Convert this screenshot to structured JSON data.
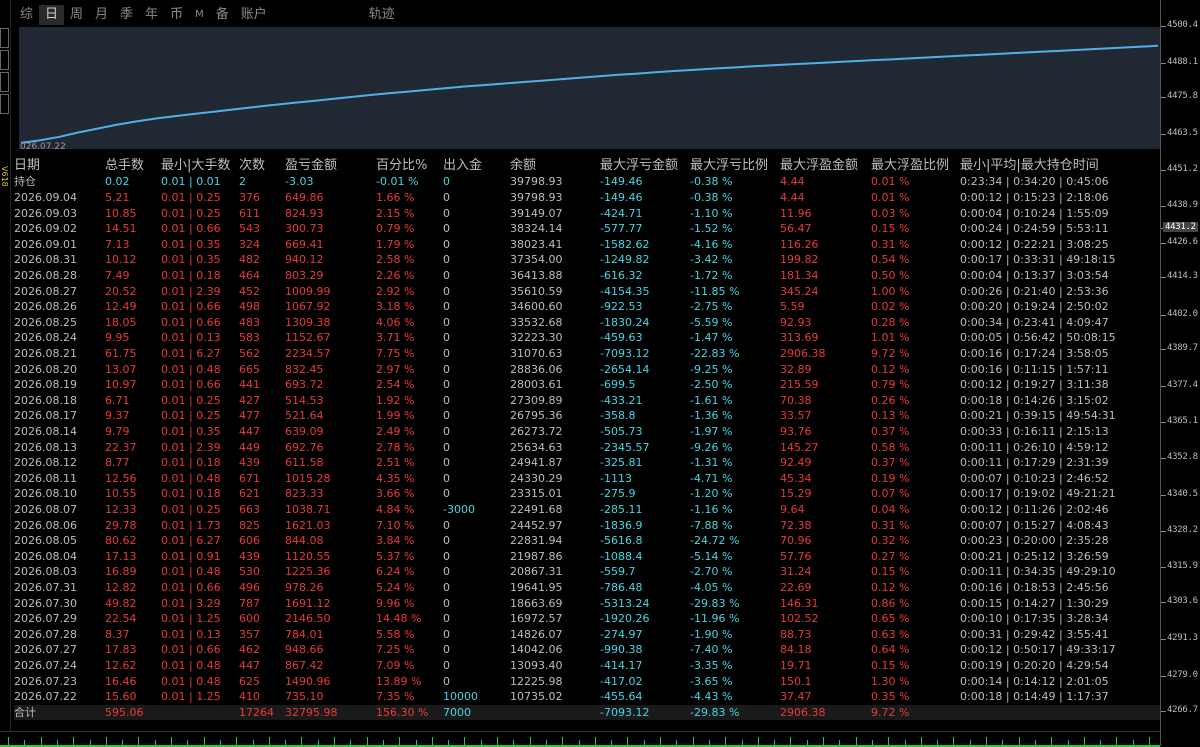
{
  "tabs": [
    {
      "label": "综",
      "active": false
    },
    {
      "label": "日",
      "active": true
    },
    {
      "label": "周",
      "active": false
    },
    {
      "label": "月",
      "active": false
    },
    {
      "label": "季",
      "active": false
    },
    {
      "label": "年",
      "active": false
    },
    {
      "label": "币",
      "active": false
    },
    {
      "label": "M",
      "active": false,
      "small": true
    },
    {
      "label": "备",
      "active": false
    },
    {
      "label": "账户",
      "active": false
    },
    {
      "label": "轨迹",
      "active": false,
      "gap": true
    }
  ],
  "chart_data": {
    "type": "line",
    "x_label_start": "026.07.22",
    "ylim": [
      4455,
      4505
    ],
    "color": "#4fb0e6",
    "values": [
      4457.5,
      4458.6,
      4460.0,
      4461.8,
      4463.4,
      4465.0,
      4466.3,
      4467.5,
      4468.5,
      4469.4,
      4470.3,
      4471.2,
      4472.1,
      4473.0,
      4473.8,
      4474.6,
      4475.4,
      4476.2,
      4477.0,
      4477.8,
      4478.5,
      4479.2,
      4479.9,
      4480.6,
      4481.2,
      4481.8,
      4482.4,
      4483.0,
      4483.6,
      4484.2,
      4484.8,
      4485.4,
      4485.9,
      4486.5,
      4487.0,
      4487.5,
      4488.0,
      4488.4,
      4488.9,
      4489.3,
      4489.7,
      4490.1,
      4490.5,
      4490.9,
      4491.3,
      4491.7,
      4492.1,
      4492.5,
      4492.9,
      4493.3,
      4493.7,
      4494.1,
      4494.5,
      4494.9,
      4495.3,
      4495.7,
      4496.1,
      4496.5,
      4496.9,
      4497.3
    ]
  },
  "axis_labels": [
    "4500.4",
    "4488.1",
    "4475.8",
    "4463.5",
    "4451.2",
    "4438.9",
    "4431.2",
    "4426.6",
    "4414.3",
    "4402.0",
    "4389.7",
    "4377.4",
    "4365.1",
    "4352.8",
    "4340.5",
    "4328.2",
    "4315.9",
    "4303.6",
    "4291.3",
    "4279.0",
    "4266.7"
  ],
  "axis_highlight": "4431.2",
  "left_strip_text": "V618",
  "table": {
    "headers": [
      "日期",
      "总手数",
      "最小|大手数",
      "次数",
      "盈亏金额",
      "百分比%",
      "出入金",
      "余额",
      "最大浮亏金额",
      "最大浮亏比例",
      "最大浮盈金额",
      "最大浮盈比例",
      "最小|平均|最大持仓时间"
    ],
    "position_row": [
      "持仓",
      "0.02",
      "0.01 | 0.01",
      "2",
      "-3.03",
      "-0.01 %",
      "0",
      "39798.93",
      "-149.46",
      "-0.38 %",
      "4.44",
      "0.01 %",
      "0:23:34 | 0:34:20 | 0:45:06"
    ],
    "rows": [
      [
        "2026.09.04",
        "5.21",
        "0.01 | 0.25",
        "376",
        "649.86",
        "1.66 %",
        "0",
        "39798.93",
        "-149.46",
        "-0.38 %",
        "4.44",
        "0.01 %",
        "0:00:12 | 0:15:23 | 2:18:06"
      ],
      [
        "2026.09.03",
        "10.85",
        "0.01 | 0.25",
        "611",
        "824.93",
        "2.15 %",
        "0",
        "39149.07",
        "-424.71",
        "-1.10 %",
        "11.96",
        "0.03 %",
        "0:00:04 | 0:10:24 | 1:55:09"
      ],
      [
        "2026.09.02",
        "14.51",
        "0.01 | 0.66",
        "543",
        "300.73",
        "0.79 %",
        "0",
        "38324.14",
        "-577.77",
        "-1.52 %",
        "56.47",
        "0.15 %",
        "0:00:24 | 0:24:59 | 5:53:11"
      ],
      [
        "2026.09.01",
        "7.13",
        "0.01 | 0.35",
        "324",
        "669.41",
        "1.79 %",
        "0",
        "38023.41",
        "-1582.62",
        "-4.16 %",
        "116.26",
        "0.31 %",
        "0:00:12 | 0:22:21 | 3:08:25"
      ],
      [
        "2026.08.31",
        "10.12",
        "0.01 | 0.35",
        "482",
        "940.12",
        "2.58 %",
        "0",
        "37354.00",
        "-1249.82",
        "-3.42 %",
        "199.82",
        "0.54 %",
        "0:00:17 | 0:33:31 | 49:18:15"
      ],
      [
        "2026.08.28",
        "7.49",
        "0.01 | 0.18",
        "464",
        "803.29",
        "2.26 %",
        "0",
        "36413.88",
        "-616.32",
        "-1.72 %",
        "181.34",
        "0.50 %",
        "0:00:04 | 0:13:37 | 3:03:54"
      ],
      [
        "2026.08.27",
        "20.52",
        "0.01 | 2.39",
        "452",
        "1009.99",
        "2.92 %",
        "0",
        "35610.59",
        "-4154.35",
        "-11.85 %",
        "345.24",
        "1.00 %",
        "0:00:26 | 0:21:40 | 2:53:36"
      ],
      [
        "2026.08.26",
        "12.49",
        "0.01 | 0.66",
        "498",
        "1067.92",
        "3.18 %",
        "0",
        "34600.60",
        "-922.53",
        "-2.75 %",
        "5.59",
        "0.02 %",
        "0:00:20 | 0:19:24 | 2:50:02"
      ],
      [
        "2026.08.25",
        "18.05",
        "0.01 | 0.66",
        "483",
        "1309.38",
        "4.06 %",
        "0",
        "33532.68",
        "-1830.24",
        "-5.59 %",
        "92.93",
        "0.28 %",
        "0:00:34 | 0:23:41 | 4:09:47"
      ],
      [
        "2026.08.24",
        "9.95",
        "0.01 | 0.13",
        "583",
        "1152.67",
        "3.71 %",
        "0",
        "32223.30",
        "-459.63",
        "-1.47 %",
        "313.69",
        "1.01 %",
        "0:00:05 | 0:56:42 | 50:08:15"
      ],
      [
        "2026.08.21",
        "61.75",
        "0.01 | 6.27",
        "562",
        "2234.57",
        "7.75 %",
        "0",
        "31070.63",
        "-7093.12",
        "-22.83 %",
        "2906.38",
        "9.72 %",
        "0:00:16 | 0:17:24 | 3:58:05"
      ],
      [
        "2026.08.20",
        "13.07",
        "0.01 | 0.48",
        "665",
        "832.45",
        "2.97 %",
        "0",
        "28836.06",
        "-2654.14",
        "-9.25 %",
        "32.89",
        "0.12 %",
        "0:00:16 | 0:11:15 | 1:57:11"
      ],
      [
        "2026.08.19",
        "10.97",
        "0.01 | 0.66",
        "441",
        "693.72",
        "2.54 %",
        "0",
        "28003.61",
        "-699.5",
        "-2.50 %",
        "215.59",
        "0.79 %",
        "0:00:12 | 0:19:27 | 3:11:38"
      ],
      [
        "2026.08.18",
        "6.71",
        "0.01 | 0.25",
        "427",
        "514.53",
        "1.92 %",
        "0",
        "27309.89",
        "-433.21",
        "-1.61 %",
        "70.38",
        "0.26 %",
        "0:00:18 | 0:14:26 | 3:15:02"
      ],
      [
        "2026.08.17",
        "9.37",
        "0.01 | 0.25",
        "477",
        "521.64",
        "1.99 %",
        "0",
        "26795.36",
        "-358.8",
        "-1.36 %",
        "33.57",
        "0.13 %",
        "0:00:21 | 0:39:15 | 49:54:31"
      ],
      [
        "2026.08.14",
        "9.79",
        "0.01 | 0.35",
        "447",
        "639.09",
        "2.49 %",
        "0",
        "26273.72",
        "-505.73",
        "-1.97 %",
        "93.76",
        "0.37 %",
        "0:00:33 | 0:16:11 | 2:15:13"
      ],
      [
        "2026.08.13",
        "22.37",
        "0.01 | 2.39",
        "449",
        "692.76",
        "2.78 %",
        "0",
        "25634.63",
        "-2345.57",
        "-9.26 %",
        "145.27",
        "0.58 %",
        "0:00:11 | 0:26:10 | 4:59:12"
      ],
      [
        "2026.08.12",
        "8.77",
        "0.01 | 0.18",
        "439",
        "611.58",
        "2.51 %",
        "0",
        "24941.87",
        "-325.81",
        "-1.31 %",
        "92.49",
        "0.37 %",
        "0:00:11 | 0:17:29 | 2:31:39"
      ],
      [
        "2026.08.11",
        "12.56",
        "0.01 | 0.48",
        "671",
        "1015.28",
        "4.35 %",
        "0",
        "24330.29",
        "-1113",
        "-4.71 %",
        "45.34",
        "0.19 %",
        "0:00:07 | 0:10:23 | 2:46:52"
      ],
      [
        "2026.08.10",
        "10.55",
        "0.01 | 0.18",
        "621",
        "823.33",
        "3.66 %",
        "0",
        "23315.01",
        "-275.9",
        "-1.20 %",
        "15.29",
        "0.07 %",
        "0:00:17 | 0:19:02 | 49:21:21"
      ],
      [
        "2026.08.07",
        "12.33",
        "0.01 | 0.25",
        "663",
        "1038.71",
        "4.84 %",
        "-3000",
        "22491.68",
        "-285.11",
        "-1.16 %",
        "9.64",
        "0.04 %",
        "0:00:12 | 0:11:26 | 2:02:46"
      ],
      [
        "2026.08.06",
        "29.78",
        "0.01 | 1.73",
        "825",
        "1621.03",
        "7.10 %",
        "0",
        "24452.97",
        "-1836.9",
        "-7.88 %",
        "72.38",
        "0.31 %",
        "0:00:07 | 0:15:27 | 4:08:43"
      ],
      [
        "2026.08.05",
        "80.62",
        "0.01 | 6.27",
        "606",
        "844.08",
        "3.84 %",
        "0",
        "22831.94",
        "-5616.8",
        "-24.72 %",
        "70.96",
        "0.32 %",
        "0:00:23 | 0:20:00 | 2:35:28"
      ],
      [
        "2026.08.04",
        "17.13",
        "0.01 | 0.91",
        "439",
        "1120.55",
        "5.37 %",
        "0",
        "21987.86",
        "-1088.4",
        "-5.14 %",
        "57.76",
        "0.27 %",
        "0:00:21 | 0:25:12 | 3:26:59"
      ],
      [
        "2026.08.03",
        "16.89",
        "0.01 | 0.48",
        "530",
        "1225.36",
        "6.24 %",
        "0",
        "20867.31",
        "-559.7",
        "-2.70 %",
        "31.24",
        "0.15 %",
        "0:00:11 | 0:34:35 | 49:29:10"
      ],
      [
        "2026.07.31",
        "12.82",
        "0.01 | 0.66",
        "496",
        "978.26",
        "5.24 %",
        "0",
        "19641.95",
        "-786.48",
        "-4.05 %",
        "22.69",
        "0.12 %",
        "0:00:16 | 0:18:53 | 2:45:56"
      ],
      [
        "2026.07.30",
        "49.82",
        "0.01 | 3.29",
        "787",
        "1691.12",
        "9.96 %",
        "0",
        "18663.69",
        "-5313.24",
        "-29.83 %",
        "146.31",
        "0.86 %",
        "0:00:15 | 0:14:27 | 1:30:29"
      ],
      [
        "2026.07.29",
        "22.54",
        "0.01 | 1.25",
        "600",
        "2146.50",
        "14.48 %",
        "0",
        "16972.57",
        "-1920.26",
        "-11.96 %",
        "102.52",
        "0.65 %",
        "0:00:10 | 0:17:35 | 3:28:34"
      ],
      [
        "2026.07.28",
        "8.37",
        "0.01 | 0.13",
        "357",
        "784.01",
        "5.58 %",
        "0",
        "14826.07",
        "-274.97",
        "-1.90 %",
        "88.73",
        "0.63 %",
        "0:00:31 | 0:29:42 | 3:55:41"
      ],
      [
        "2026.07.27",
        "17.83",
        "0.01 | 0.66",
        "462",
        "948.66",
        "7.25 %",
        "0",
        "14042.06",
        "-990.38",
        "-7.40 %",
        "84.18",
        "0.64 %",
        "0:00:12 | 0:50:17 | 49:33:17"
      ],
      [
        "2026.07.24",
        "12.62",
        "0.01 | 0.48",
        "447",
        "867.42",
        "7.09 %",
        "0",
        "13093.40",
        "-414.17",
        "-3.35 %",
        "19.71",
        "0.15 %",
        "0:00:19 | 0:20:20 | 4:29:54"
      ],
      [
        "2026.07.23",
        "16.46",
        "0.01 | 0.48",
        "625",
        "1490.96",
        "13.89 %",
        "0",
        "12225.98",
        "-417.02",
        "-3.65 %",
        "150.1",
        "1.30 %",
        "0:00:14 | 0:14:12 | 2:01:05"
      ],
      [
        "2026.07.22",
        "15.60",
        "0.01 | 1.25",
        "410",
        "735.10",
        "7.35 %",
        "10000",
        "10735.02",
        "-455.64",
        "-4.43 %",
        "37.47",
        "0.35 %",
        "0:00:18 | 0:14:49 | 1:17:37"
      ]
    ],
    "total_row": [
      "合计",
      "595.06",
      "",
      "17264",
      "32795.98",
      "156.30 %",
      "7000",
      "",
      "-7093.12",
      "-29.83 %",
      "2906.38",
      "9.72 %",
      ""
    ]
  },
  "colors": {
    "red": "#e63b3b",
    "cyan": "#45d6e6",
    "grey": "#bdbdbd",
    "line": "#4fb0e6",
    "chart_bg": "#212733"
  }
}
